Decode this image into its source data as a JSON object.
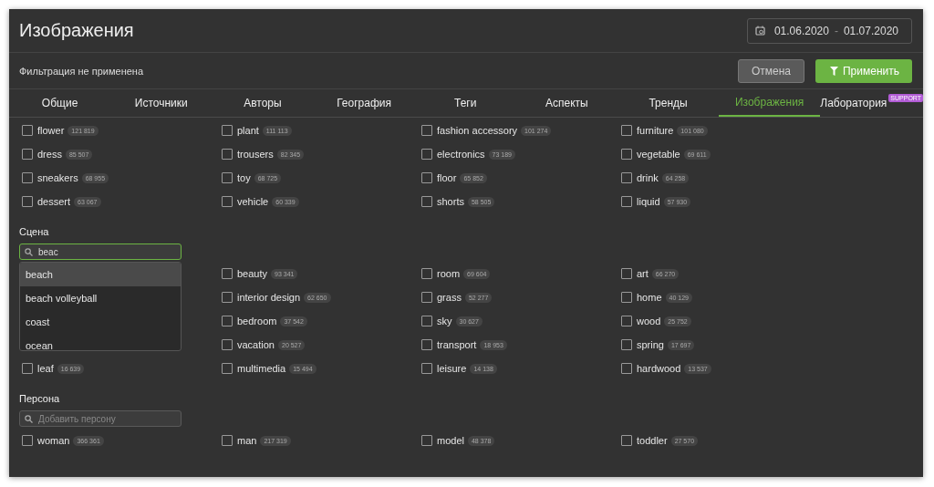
{
  "title": "Изображения",
  "date_range": {
    "from": "01.06.2020",
    "separator": "-",
    "to": "01.07.2020"
  },
  "filter_status": "Фильтрация не применена",
  "buttons": {
    "cancel": "Отмена",
    "apply": "Применить"
  },
  "tabs": [
    {
      "label": "Общие",
      "selected": false
    },
    {
      "label": "Источники",
      "selected": false
    },
    {
      "label": "Авторы",
      "selected": false
    },
    {
      "label": "География",
      "selected": false
    },
    {
      "label": "Теги",
      "selected": false
    },
    {
      "label": "Аспекты",
      "selected": false
    },
    {
      "label": "Тренды",
      "selected": false
    },
    {
      "label": "Изображения",
      "selected": true
    },
    {
      "label": "Лаборатория",
      "selected": false,
      "badge": "SUPPORT"
    }
  ],
  "objects": {
    "columns": [
      [
        {
          "name": "flower",
          "count": "121 819",
          "checked": false
        },
        {
          "name": "dress",
          "count": "85 507",
          "checked": false
        },
        {
          "name": "sneakers",
          "count": "68 955",
          "checked": false
        },
        {
          "name": "dessert",
          "count": "63 067",
          "checked": false
        }
      ],
      [
        {
          "name": "plant",
          "count": "111 113",
          "checked": false
        },
        {
          "name": "trousers",
          "count": "82 345",
          "checked": false
        },
        {
          "name": "toy",
          "count": "68 725",
          "checked": false
        },
        {
          "name": "vehicle",
          "count": "60 339",
          "checked": false
        }
      ],
      [
        {
          "name": "fashion accessory",
          "count": "101 274",
          "checked": false
        },
        {
          "name": "electronics",
          "count": "73 189",
          "checked": false
        },
        {
          "name": "floor",
          "count": "65 852",
          "checked": false
        },
        {
          "name": "shorts",
          "count": "58 505",
          "checked": false
        }
      ],
      [
        {
          "name": "furniture",
          "count": "101 080",
          "checked": false
        },
        {
          "name": "vegetable",
          "count": "69 611",
          "checked": false
        },
        {
          "name": "drink",
          "count": "64 258",
          "checked": false
        },
        {
          "name": "liquid",
          "count": "57 930",
          "checked": false
        }
      ]
    ]
  },
  "scene": {
    "heading": "Сцена",
    "search": {
      "value": "beac",
      "focused": true
    },
    "suggestions": [
      {
        "label": "beach",
        "selected": true
      },
      {
        "label": "beach volleyball",
        "selected": false
      },
      {
        "label": "coast",
        "selected": false
      },
      {
        "label": "ocean",
        "selected": false
      }
    ],
    "columns": [
      [
        {
          "name": "leaf",
          "count": "16 639",
          "checked": false
        }
      ],
      [
        {
          "name": "beauty",
          "count": "93 341",
          "checked": false
        },
        {
          "name": "interior design",
          "count": "62 650",
          "checked": false
        },
        {
          "name": "bedroom",
          "count": "37 542",
          "checked": false
        },
        {
          "name": "vacation",
          "count": "20 527",
          "checked": false
        },
        {
          "name": "multimedia",
          "count": "15 494",
          "checked": false
        }
      ],
      [
        {
          "name": "room",
          "count": "69 604",
          "checked": false
        },
        {
          "name": "grass",
          "count": "52 277",
          "checked": false
        },
        {
          "name": "sky",
          "count": "30 627",
          "checked": false
        },
        {
          "name": "transport",
          "count": "18 953",
          "checked": false
        },
        {
          "name": "leisure",
          "count": "14 138",
          "checked": false
        }
      ],
      [
        {
          "name": "art",
          "count": "66 270",
          "checked": false
        },
        {
          "name": "home",
          "count": "40 129",
          "checked": false
        },
        {
          "name": "wood",
          "count": "25 752",
          "checked": false
        },
        {
          "name": "spring",
          "count": "17 697",
          "checked": false
        },
        {
          "name": "hardwood",
          "count": "13 537",
          "checked": false
        }
      ]
    ]
  },
  "persona": {
    "heading": "Персона",
    "search": {
      "placeholder": "Добавить персону",
      "focused": false
    },
    "columns": [
      [
        {
          "name": "woman",
          "count": "366 361",
          "checked": false
        }
      ],
      [
        {
          "name": "man",
          "count": "217 319",
          "checked": false
        }
      ],
      [
        {
          "name": "model",
          "count": "48 378",
          "checked": false
        }
      ],
      [
        {
          "name": "toddler",
          "count": "27 570",
          "checked": false
        }
      ]
    ]
  }
}
